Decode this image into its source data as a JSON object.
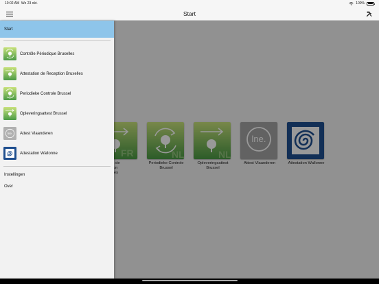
{
  "status_bar": {
    "time": "10:02 AM",
    "date": "Wo 23 okt.",
    "battery": "100%",
    "icons": [
      "wifi-icon",
      "battery-icon"
    ]
  },
  "nav": {
    "title": "Start",
    "left_icon": "hamburger-menu-icon",
    "right_icon": "tools-icon"
  },
  "drawer": {
    "start_label": "Start",
    "items": [
      {
        "label": "Contrôle Périodique Bruxelles",
        "icon": "periodic-control-fr-icon"
      },
      {
        "label": "Attestation de Reception Bruxelles",
        "icon": "reception-attest-fr-icon"
      },
      {
        "label": "Periodieke Controle Brussel",
        "icon": "periodic-control-nl-icon"
      },
      {
        "label": "Opleveringsattest Brussel",
        "icon": "delivery-attest-nl-icon"
      },
      {
        "label": "Attest Vlaanderen",
        "icon": "lne-logo-icon"
      },
      {
        "label": "Attestation Wallonne",
        "icon": "wallonia-logo-icon"
      }
    ],
    "footer_links": [
      "Instellingen",
      "Over"
    ]
  },
  "tiles": [
    {
      "label": "Attestation de Reception Bruxelles",
      "visible_label": "station de\nception\nruxelles",
      "icon": "reception-attest-fr-icon",
      "badge": "FR"
    },
    {
      "label": "Periodieke Controle Brussel",
      "icon": "periodic-control-nl-icon",
      "badge": "NL"
    },
    {
      "label": "Opleveringsattest Brussel",
      "icon": "delivery-attest-nl-icon",
      "badge": "NL"
    },
    {
      "label": "Attest Vlaanderen",
      "icon": "lne-logo-icon",
      "logo_text": "lne."
    },
    {
      "label": "Attestation Wallonne",
      "icon": "wallonia-logo-icon"
    }
  ],
  "colors": {
    "highlight": "#8ec5ea",
    "tile_green_top": "#c5e07a",
    "tile_green_bottom": "#4c9b46",
    "lne_gray": "#a3a3a3",
    "wallonia_blue": "#1f4f8f"
  }
}
